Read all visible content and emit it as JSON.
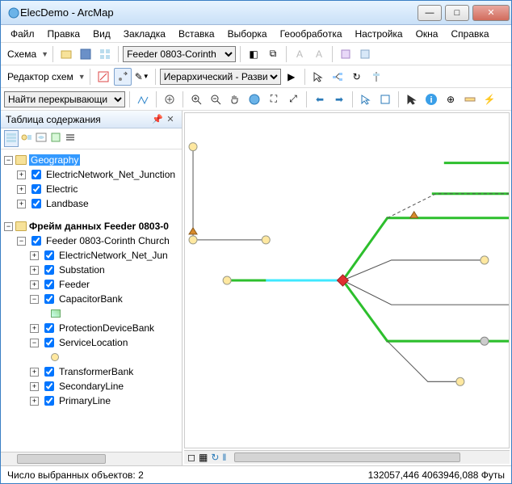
{
  "window": {
    "title": "ElecDemo - ArcMap"
  },
  "menu": [
    "Файл",
    "Правка",
    "Вид",
    "Закладка",
    "Вставка",
    "Выборка",
    "Геообработка",
    "Настройка",
    "Окна",
    "Справка"
  ],
  "toolbar1": {
    "schema_label": "Схема",
    "feeder_select": "Feeder 0803-Corinth"
  },
  "toolbar2": {
    "editor_label": "Редактор схем",
    "layout_select": "Иерархический - Разви"
  },
  "toolbar3": {
    "find_label": "Найти перекрывающи"
  },
  "toc": {
    "title": "Таблица содержания",
    "df1": {
      "name": "Geography",
      "items": [
        "ElectricNetwork_Net_Junction",
        "Electric",
        "Landbase"
      ]
    },
    "df2": {
      "name": "Фрейм данных Feeder 0803-0",
      "layer": "Feeder 0803-Corinth Church",
      "items": [
        "ElectricNetwork_Net_Jun",
        "Substation",
        "Feeder",
        "CapacitorBank",
        "ProtectionDeviceBank",
        "ServiceLocation",
        "TransformerBank",
        "SecondaryLine",
        "PrimaryLine"
      ]
    }
  },
  "status": {
    "selected": "Число выбранных объектов: 2",
    "coords": "132057,446 4063946,088 Футы"
  }
}
